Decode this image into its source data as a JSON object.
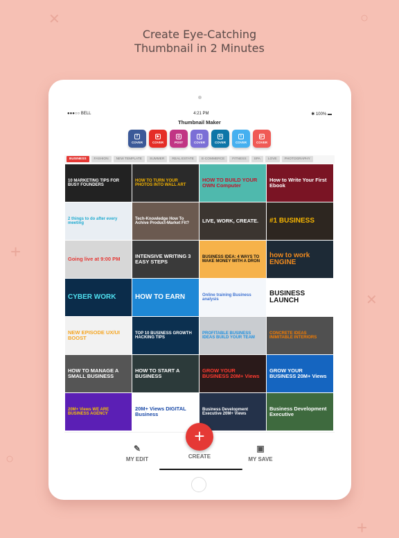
{
  "headline": [
    "Create Eye-Catching",
    "Thumbnail in 2 Minutes"
  ],
  "status": {
    "carrier": "●●●○○ BELL",
    "time": "4:21 PM",
    "battery": "100%"
  },
  "app_title": "Thumbnail Maker",
  "socials": [
    {
      "icon": "facebook-icon",
      "glyph": "f",
      "label": "COVER",
      "color": "#3b5998"
    },
    {
      "icon": "youtube-icon",
      "glyph": "▶",
      "label": "COVER",
      "color": "#e52d27"
    },
    {
      "icon": "instagram-icon",
      "glyph": "◎",
      "label": "POST",
      "color": "#c13584"
    },
    {
      "icon": "book-icon",
      "glyph": "▯",
      "label": "COVER",
      "color": "#7b6fd6"
    },
    {
      "icon": "linkedin-icon",
      "glyph": "in",
      "label": "COVER",
      "color": "#0e76a8"
    },
    {
      "icon": "twitter-icon",
      "glyph": "t",
      "label": "COVER",
      "color": "#45b0f0"
    },
    {
      "icon": "google-plus-icon",
      "glyph": "g+",
      "label": "COVER",
      "color": "#f05a55"
    }
  ],
  "categories": [
    "BUSINESS",
    "FASHION",
    "NEW TEMPLATE",
    "SUMMER",
    "REAL ESTATE",
    "E-COMMERCE",
    "FITNESS",
    "SPA",
    "LOVE",
    "PHOTOGRAPHY"
  ],
  "active_category": "BUSINESS",
  "thumbnails": [
    {
      "text": "10 MARKETING TIPS FOR BUSY FOUNDERS",
      "bg": "#222",
      "fg": "#fff"
    },
    {
      "text": "HOW TO TURN YOUR PHOTOS INTO WALL ART",
      "bg": "#2a2a2a",
      "fg": "#f5b400"
    },
    {
      "text": "HOW TO BUILD YOUR OWN Computer",
      "bg": "#4fb9ad",
      "fg": "#c0152b"
    },
    {
      "text": "How to Write Your First Ebook",
      "bg": "#7a1424",
      "fg": "#fff"
    },
    {
      "text": "2 things to do after every meeting",
      "bg": "#e9eef3",
      "fg": "#1eaad0"
    },
    {
      "text": "Tech-Knowledge How To Achive Product-Market Fit?",
      "bg": "#6b5a50",
      "fg": "#fff"
    },
    {
      "text": "LIVE, WORK, CREATE.",
      "bg": "#3b3530",
      "fg": "#fff"
    },
    {
      "text": "#1 BUSINESS",
      "bg": "#2d2620",
      "fg": "#f5b400"
    },
    {
      "text": "Going live at 9:00 PM",
      "bg": "#d7d7d7",
      "fg": "#e53935"
    },
    {
      "text": "INTENSIVE WRITING 3 EASY STEPS",
      "bg": "#3a3a3a",
      "fg": "#fff"
    },
    {
      "text": "BUSINESS IDEA: 4 WAYS TO MAKE MONEY WITH A DRON",
      "bg": "#f6b24a",
      "fg": "#111"
    },
    {
      "text": "how to work ENGINE",
      "bg": "#1d2a36",
      "fg": "#f08a1e"
    },
    {
      "text": "CYBER WORK",
      "bg": "#0b2c4a",
      "fg": "#4fe0f0"
    },
    {
      "text": "HOW TO EARN",
      "bg": "#1e88d6",
      "fg": "#fff"
    },
    {
      "text": "Online training Business analysis",
      "bg": "#f4f7fb",
      "fg": "#3a6fd0"
    },
    {
      "text": "BUSINESS LAUNCH",
      "bg": "#fff",
      "fg": "#111"
    },
    {
      "text": "NEW EPISODE UX/UI BOOST",
      "bg": "#f2f2f2",
      "fg": "#f5a623"
    },
    {
      "text": "TOP 10 BUSINESS GROWTH HACKING TIPS",
      "bg": "#0c3050",
      "fg": "#fff"
    },
    {
      "text": "PROFITABLE BUSINESS IDEAS BUILD YOUR TEAM",
      "bg": "#c9ccd0",
      "fg": "#1e90e0"
    },
    {
      "text": "CONCRETE IDEAS INIMITABLE INTERIORS",
      "bg": "#505050",
      "fg": "#f57c00"
    },
    {
      "text": "HOW TO MANAGE A SMALL BUSINESS",
      "bg": "#555",
      "fg": "#fff"
    },
    {
      "text": "HOW TO START A BUSINESS",
      "bg": "#2c3a3a",
      "fg": "#fff"
    },
    {
      "text": "GROW YOUR BUSINESS 20M+ Views",
      "bg": "#2a1a1a",
      "fg": "#ff3b30"
    },
    {
      "text": "GROW YOUR BUSINESS 20M+ Views",
      "bg": "#1565c0",
      "fg": "#fff"
    },
    {
      "text": "20M+ Views WE ARE BUSINESS AGENCY",
      "bg": "#5b1fb5",
      "fg": "#f5c400"
    },
    {
      "text": "20M+ Views DIGITAL Business",
      "bg": "#fff",
      "fg": "#1747a6"
    },
    {
      "text": "Business Development Executive 20M+ Views",
      "bg": "#24324a",
      "fg": "#fff"
    },
    {
      "text": "Business Development Executive",
      "bg": "#3e6a3e",
      "fg": "#fff"
    }
  ],
  "nav": {
    "my_edit": "MY EDIT",
    "create": "CREATE",
    "my_save": "MY SAVE",
    "fab": "+"
  },
  "colors": {
    "accent": "#e53935",
    "background": "#f6c0b4"
  }
}
